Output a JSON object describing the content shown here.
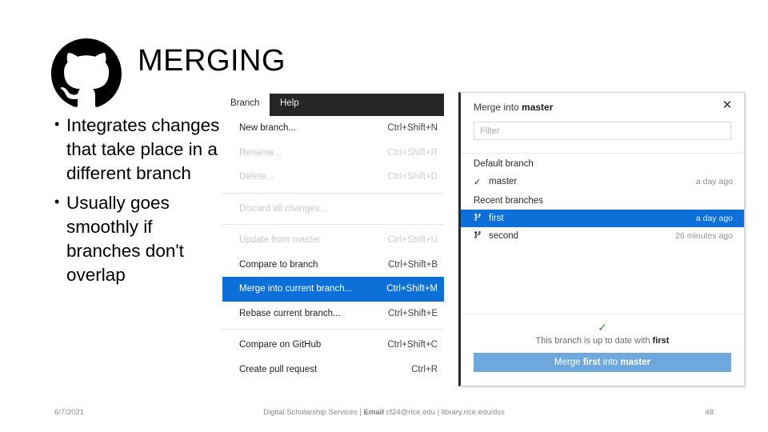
{
  "slide": {
    "title": "MERGING",
    "logo_icon": "github-octocat-logo",
    "bullets": [
      "Integrates changes that take place in a different branch",
      "Usually goes smoothly if branches don't overlap"
    ]
  },
  "branch_menu": {
    "tabs": [
      {
        "label": "Branch",
        "active": false
      },
      {
        "label": "Help",
        "active": true
      }
    ],
    "groups": [
      {
        "items": [
          {
            "label": "New branch...",
            "shortcut": "Ctrl+Shift+N",
            "state": "enabled"
          },
          {
            "label": "Rename...",
            "shortcut": "Ctrl+Shift+R",
            "state": "disabled"
          },
          {
            "label": "Delete...",
            "shortcut": "Ctrl+Shift+D",
            "state": "disabled"
          }
        ]
      },
      {
        "items": [
          {
            "label": "Discard all changes...",
            "shortcut": "",
            "state": "disabled"
          }
        ]
      },
      {
        "items": [
          {
            "label": "Update from master",
            "shortcut": "Ctrl+Shift+U",
            "state": "disabled"
          },
          {
            "label": "Compare to branch",
            "shortcut": "Ctrl+Shift+B",
            "state": "enabled"
          },
          {
            "label": "Merge into current branch...",
            "shortcut": "Ctrl+Shift+M",
            "state": "selected"
          },
          {
            "label": "Rebase current branch...",
            "shortcut": "Ctrl+Shift+E",
            "state": "enabled"
          }
        ]
      },
      {
        "items": [
          {
            "label": "Compare on GitHub",
            "shortcut": "Ctrl+Shift+C",
            "state": "enabled"
          },
          {
            "label": "Create pull request",
            "shortcut": "Ctrl+R",
            "state": "enabled"
          }
        ]
      }
    ]
  },
  "merge_dialog": {
    "title_prefix": "Merge into ",
    "title_branch": "master",
    "close_icon": "close-icon",
    "filter_placeholder": "Filter",
    "filter_value": "",
    "default_branch_label": "Default branch",
    "default_branch": {
      "icon": "check-icon",
      "name": "master",
      "time": "a day ago"
    },
    "recent_branches_label": "Recent branches",
    "recent_branches": [
      {
        "icon": "branch-icon",
        "name": "first",
        "time": "a day ago",
        "selected": true
      },
      {
        "icon": "branch-icon",
        "name": "second",
        "time": "26 minutes ago",
        "selected": false
      }
    ],
    "status_icon": "check-icon",
    "status_prefix": "This branch is up to date with ",
    "status_branch": "first",
    "merge_button": {
      "prefix": "Merge ",
      "source": "first",
      "middle": " into ",
      "target": "master"
    },
    "accent_selected": "#0d6fd8",
    "button_color": "#6fa8dd",
    "status_check_color": "#3a8c4e"
  },
  "footer": {
    "date": "6/7/2021",
    "center_prefix": "Digital Scholarship Services | ",
    "center_bold": "Email",
    "center_suffix": " cf24@rice.edu | library.rice.edu/dss",
    "page": "48"
  }
}
